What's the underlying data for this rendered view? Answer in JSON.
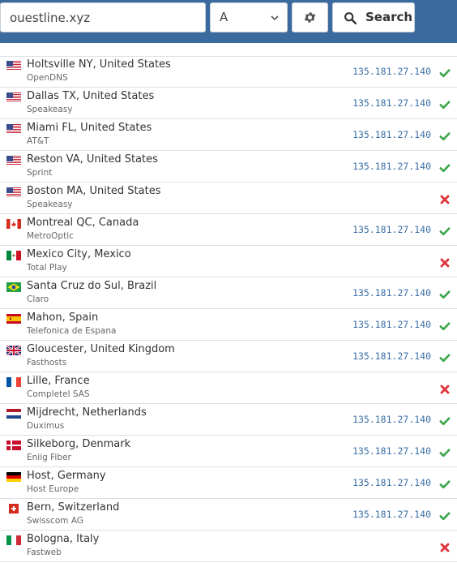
{
  "search": {
    "domain": "ouestline.xyz",
    "record_type": "A",
    "button_label": "Search"
  },
  "colors": {
    "accent": "#3b6b9e",
    "ok": "#3aa64a",
    "fail": "#e0323a",
    "ip": "#3a6fa8"
  },
  "results": [
    {
      "flag": "us",
      "location": "Holtsville NY, United States",
      "isp": "OpenDNS",
      "ip": "135.181.27.140",
      "status": "ok"
    },
    {
      "flag": "us",
      "location": "Dallas TX, United States",
      "isp": "Speakeasy",
      "ip": "135.181.27.140",
      "status": "ok"
    },
    {
      "flag": "us",
      "location": "Miami FL, United States",
      "isp": "AT&T",
      "ip": "135.181.27.140",
      "status": "ok"
    },
    {
      "flag": "us",
      "location": "Reston VA, United States",
      "isp": "Sprint",
      "ip": "135.181.27.140",
      "status": "ok"
    },
    {
      "flag": "us",
      "location": "Boston MA, United States",
      "isp": "Speakeasy",
      "ip": "",
      "status": "fail"
    },
    {
      "flag": "ca",
      "location": "Montreal QC, Canada",
      "isp": "MetroOptic",
      "ip": "135.181.27.140",
      "status": "ok"
    },
    {
      "flag": "mx",
      "location": "Mexico City, Mexico",
      "isp": "Total Play",
      "ip": "",
      "status": "fail"
    },
    {
      "flag": "br",
      "location": "Santa Cruz do Sul, Brazil",
      "isp": "Claro",
      "ip": "135.181.27.140",
      "status": "ok"
    },
    {
      "flag": "es",
      "location": "Mahon, Spain",
      "isp": "Telefonica de Espana",
      "ip": "135.181.27.140",
      "status": "ok"
    },
    {
      "flag": "gb",
      "location": "Gloucester, United Kingdom",
      "isp": "Fasthosts",
      "ip": "135.181.27.140",
      "status": "ok"
    },
    {
      "flag": "fr",
      "location": "Lille, France",
      "isp": "Completel SAS",
      "ip": "",
      "status": "fail"
    },
    {
      "flag": "nl",
      "location": "Mijdrecht, Netherlands",
      "isp": "Duximus",
      "ip": "135.181.27.140",
      "status": "ok"
    },
    {
      "flag": "dk",
      "location": "Silkeborg, Denmark",
      "isp": "Eniig Fiber",
      "ip": "135.181.27.140",
      "status": "ok"
    },
    {
      "flag": "de",
      "location": "Host, Germany",
      "isp": "Host Europe",
      "ip": "135.181.27.140",
      "status": "ok"
    },
    {
      "flag": "ch",
      "location": "Bern, Switzerland",
      "isp": "Swisscom AG",
      "ip": "135.181.27.140",
      "status": "ok"
    },
    {
      "flag": "it",
      "location": "Bologna, Italy",
      "isp": "Fastweb",
      "ip": "",
      "status": "fail"
    }
  ]
}
